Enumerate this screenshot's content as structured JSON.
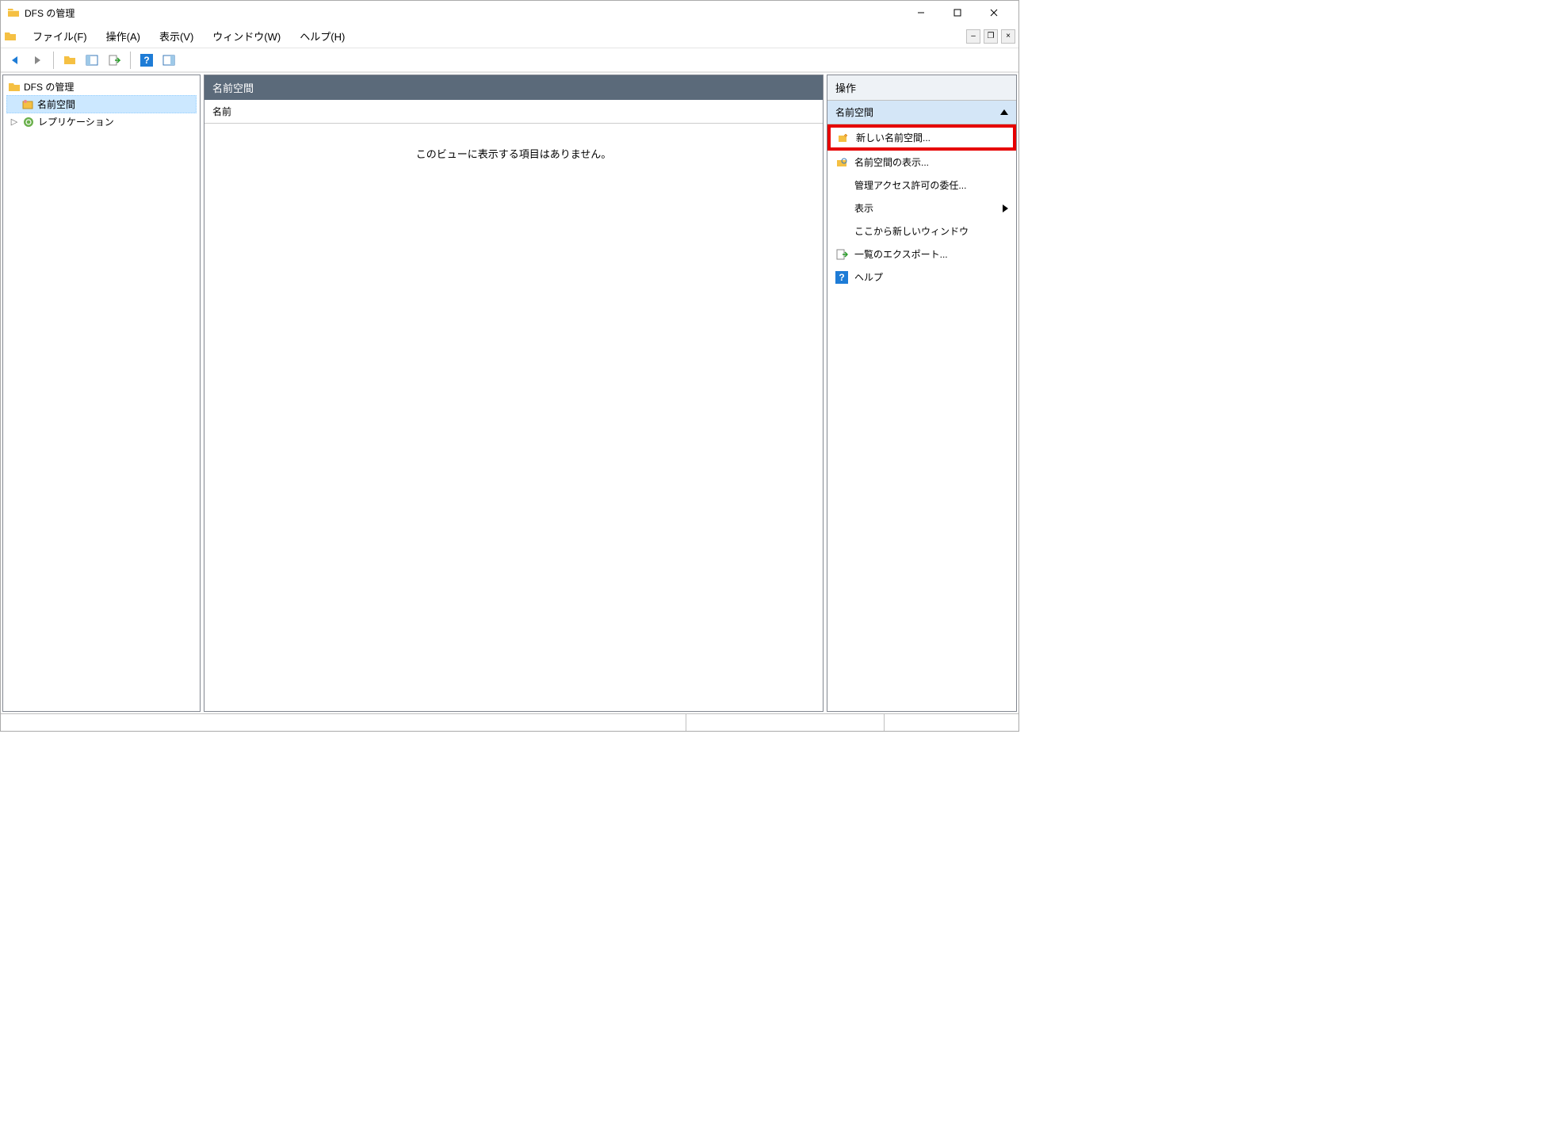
{
  "title": "DFS の管理",
  "menubar": [
    "ファイル(F)",
    "操作(A)",
    "表示(V)",
    "ウィンドウ(W)",
    "ヘルプ(H)"
  ],
  "tree": {
    "root": "DFS の管理",
    "items": [
      "名前空間",
      "レプリケーション"
    ]
  },
  "center": {
    "header": "名前空間",
    "column": "名前",
    "empty": "このビューに表示する項目はありません。"
  },
  "actions": {
    "header": "操作",
    "section": "名前空間",
    "items": [
      "新しい名前空間...",
      "名前空間の表示...",
      "管理アクセス許可の委任...",
      "表示",
      "ここから新しいウィンドウ",
      "一覧のエクスポート...",
      "ヘルプ"
    ]
  }
}
